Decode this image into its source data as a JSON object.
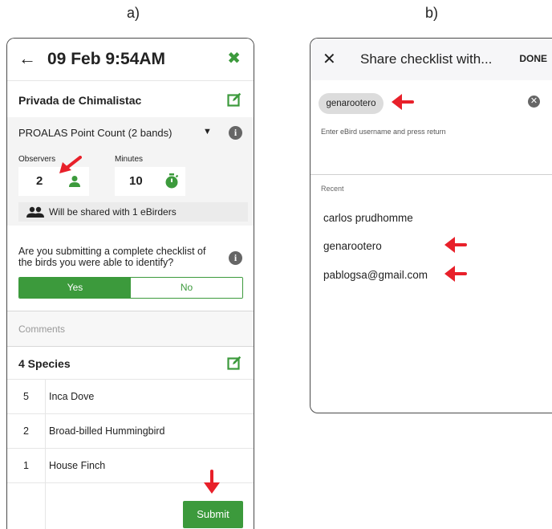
{
  "panels": {
    "a_label": "a)",
    "b_label": "b)"
  },
  "checklist": {
    "back_icon": "arrow-left-icon",
    "title": "09 Feb 9:54AM",
    "close_icon": "close-x-icon",
    "location": "Privada de Chimalistac",
    "protocol": "PROALAS Point Count (2 bands)",
    "observers_label": "Observers",
    "observers_value": "2",
    "minutes_label": "Minutes",
    "minutes_value": "10",
    "shared_text": "Will be shared with 1 eBirders",
    "question": "Are you submitting a complete checklist of the birds you were able to identify?",
    "yes_label": "Yes",
    "no_label": "No",
    "comments_placeholder": "Comments",
    "species_title": "4 Species",
    "species": [
      {
        "count": "5",
        "name": "Inca Dove"
      },
      {
        "count": "2",
        "name": "Broad-billed Hummingbird"
      },
      {
        "count": "1",
        "name": "House Finch"
      }
    ],
    "submit_label": "Submit"
  },
  "share": {
    "close_icon": "close-x-icon",
    "title": "Share checklist with...",
    "done_label": "DONE",
    "chip": "genarootero",
    "helper": "Enter eBird username and press return",
    "recent_label": "Recent",
    "recent": [
      "carlos prudhomme",
      "genarootero",
      "pablogsa@gmail.com"
    ]
  },
  "colors": {
    "accent_green": "#3c9a3c",
    "annotation_red": "#e8202a"
  }
}
